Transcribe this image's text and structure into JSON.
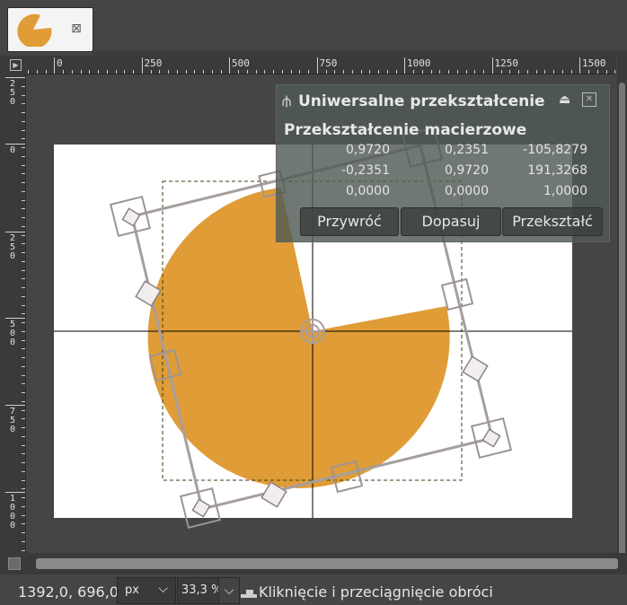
{
  "tab": {
    "close_glyph": "⊠",
    "thumb_icon": "pacman-thumbnail-icon"
  },
  "ruler": {
    "h_labels": [
      "0",
      "250",
      "500",
      "750",
      "1000",
      "1250",
      "1500"
    ],
    "v_labels": [
      "2\n5\n0",
      "0",
      "2\n5\n0",
      "5\n0\n0",
      "7\n5\n0",
      "1\n0\n0\n0"
    ]
  },
  "dialog": {
    "title": "Uniwersalne przekształcenie",
    "subtitle": "Przekształcenie macierzowe",
    "matrix": [
      [
        "0,9720",
        "0,2351",
        "-105,8279"
      ],
      [
        "-0,2351",
        "0,9720",
        "191,3268"
      ],
      [
        "0,0000",
        "0,0000",
        "1,0000"
      ]
    ],
    "buttons": {
      "reset": "Przywróć",
      "readjust": "Dopasuj",
      "transform": "Przekształć"
    }
  },
  "status": {
    "coords": "1392,0, 696,0",
    "unit": "px",
    "zoom": "33,3 %",
    "message": "Kliknięcie i przeciągnięcie obróci"
  },
  "colors": {
    "shape": "#E09C36",
    "canvas": "#FFFFFF",
    "background": "#454545"
  }
}
